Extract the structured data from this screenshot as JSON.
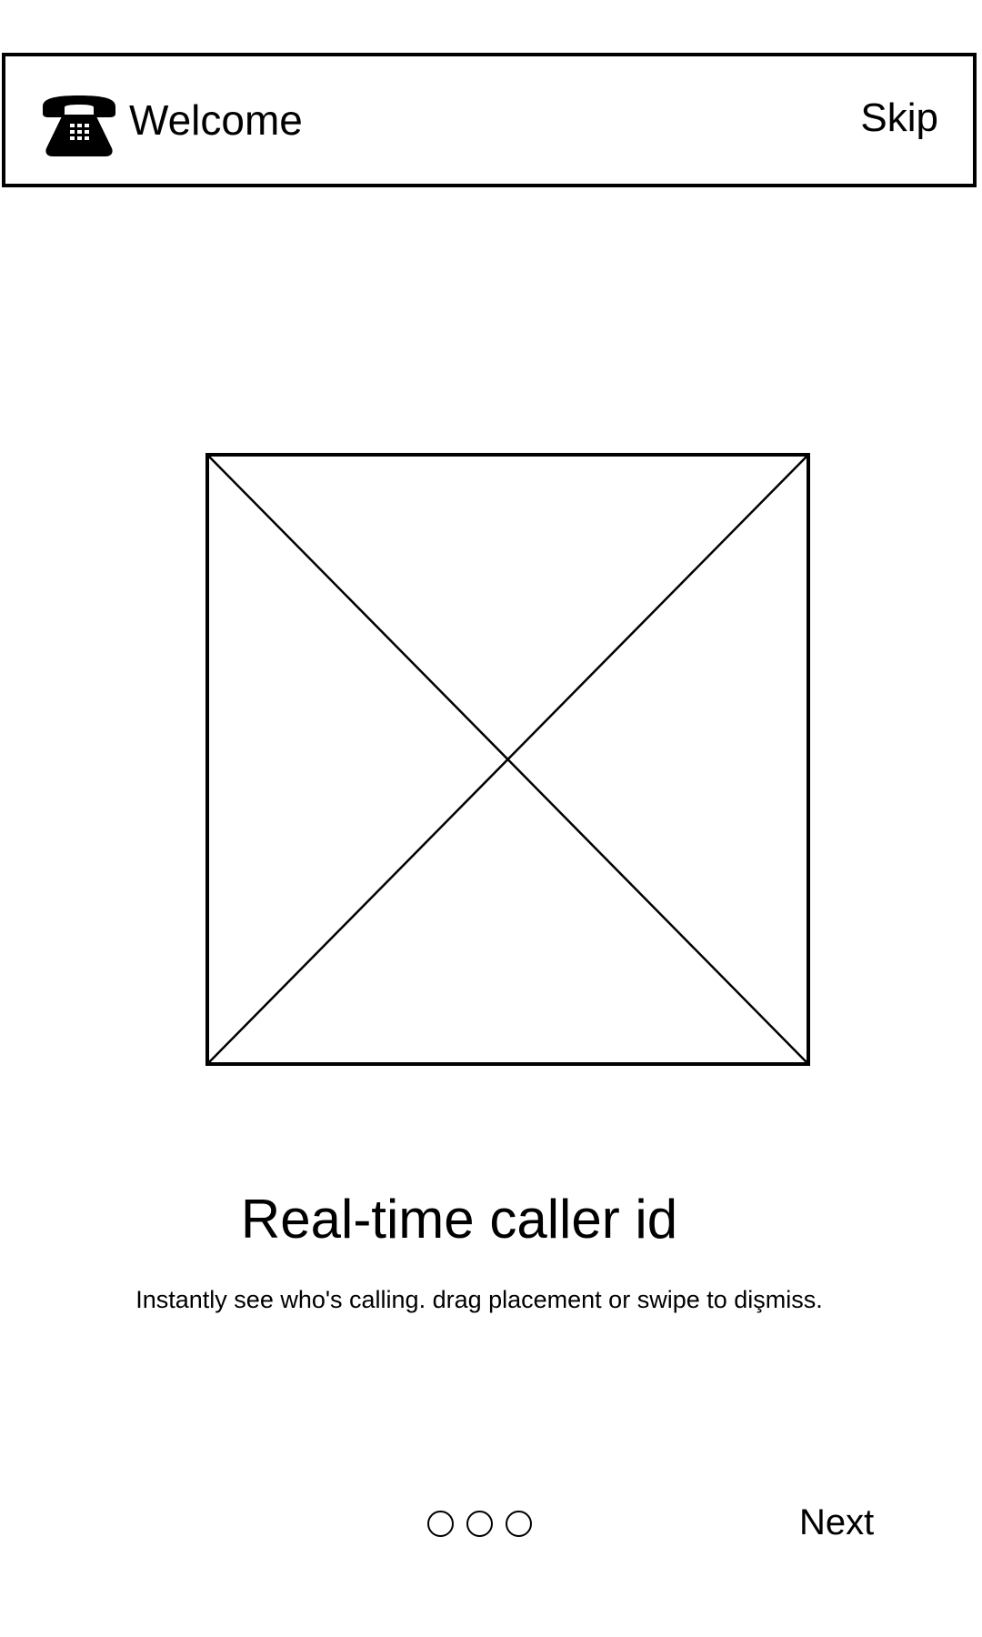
{
  "header": {
    "icon": "phone-icon",
    "title": "Welcome",
    "skip_label": "Skip"
  },
  "illustration": {
    "icon": "image-placeholder-icon"
  },
  "content": {
    "headline": "Real-time caller id",
    "description": "Instantly see who's calling. drag placement or swipe to dişmiss."
  },
  "pager": {
    "total_pages": 3
  },
  "footer": {
    "next_label": "Next"
  }
}
